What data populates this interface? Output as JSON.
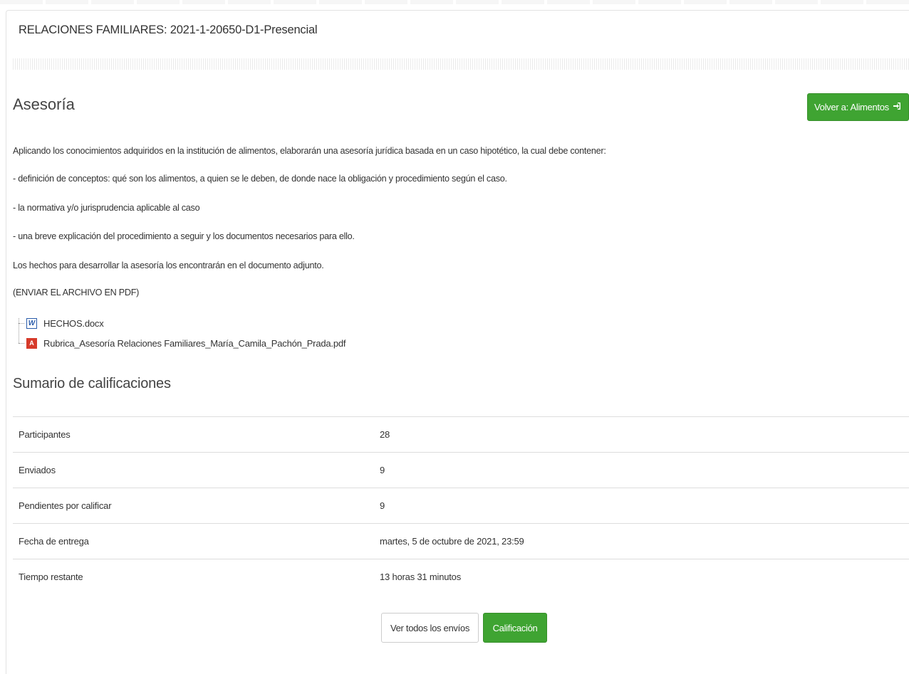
{
  "course": {
    "title": "RELACIONES FAMILIARES: 2021-1-20650-D1-Presencial"
  },
  "activity": {
    "title": "Asesoría",
    "back_button": "Volver a: Alimentos",
    "back_icon": "sign-in-icon",
    "intro": [
      "Aplicando los conocimientos adquiridos en la institución de alimentos, elaborarán una asesoría jurídica basada en un caso hipotético, la cual debe contener:",
      "- definición de conceptos: qué son los alimentos, a quien se le deben, de donde nace la obligación y procedimiento según el caso.",
      "- la normativa y/o jurisprudencia aplicable al caso",
      "- una breve explicación del procedimiento a seguir y los documentos necesarios para ello.",
      "Los hechos para desarrollar la asesoría los encontrarán en el documento adjunto.",
      "(ENVIAR EL ARCHIVO EN PDF)"
    ],
    "files": [
      {
        "name": "HECHOS.docx",
        "icon": "word-icon",
        "icon_glyph": "W"
      },
      {
        "name": "Rubrica_Asesoría Relaciones Familiares_María_Camila_Pachón_Prada.pdf",
        "icon": "pdf-icon",
        "icon_glyph": "A"
      }
    ]
  },
  "summary": {
    "title": "Sumario de calificaciones",
    "rows": [
      {
        "label": "Participantes",
        "value": "28"
      },
      {
        "label": "Enviados",
        "value": "9"
      },
      {
        "label": "Pendientes por calificar",
        "value": "9"
      },
      {
        "label": "Fecha de entrega",
        "value": "martes, 5 de octubre de 2021, 23:59"
      },
      {
        "label": "Tiempo restante",
        "value": "13 horas 31 minutos"
      }
    ]
  },
  "actions": {
    "view_all": "Ver todos los envíos",
    "grade": "Calificación"
  },
  "colors": {
    "accent_green": "#3fa432",
    "pdf_red": "#d63a2a",
    "word_blue": "#2a5caa"
  }
}
